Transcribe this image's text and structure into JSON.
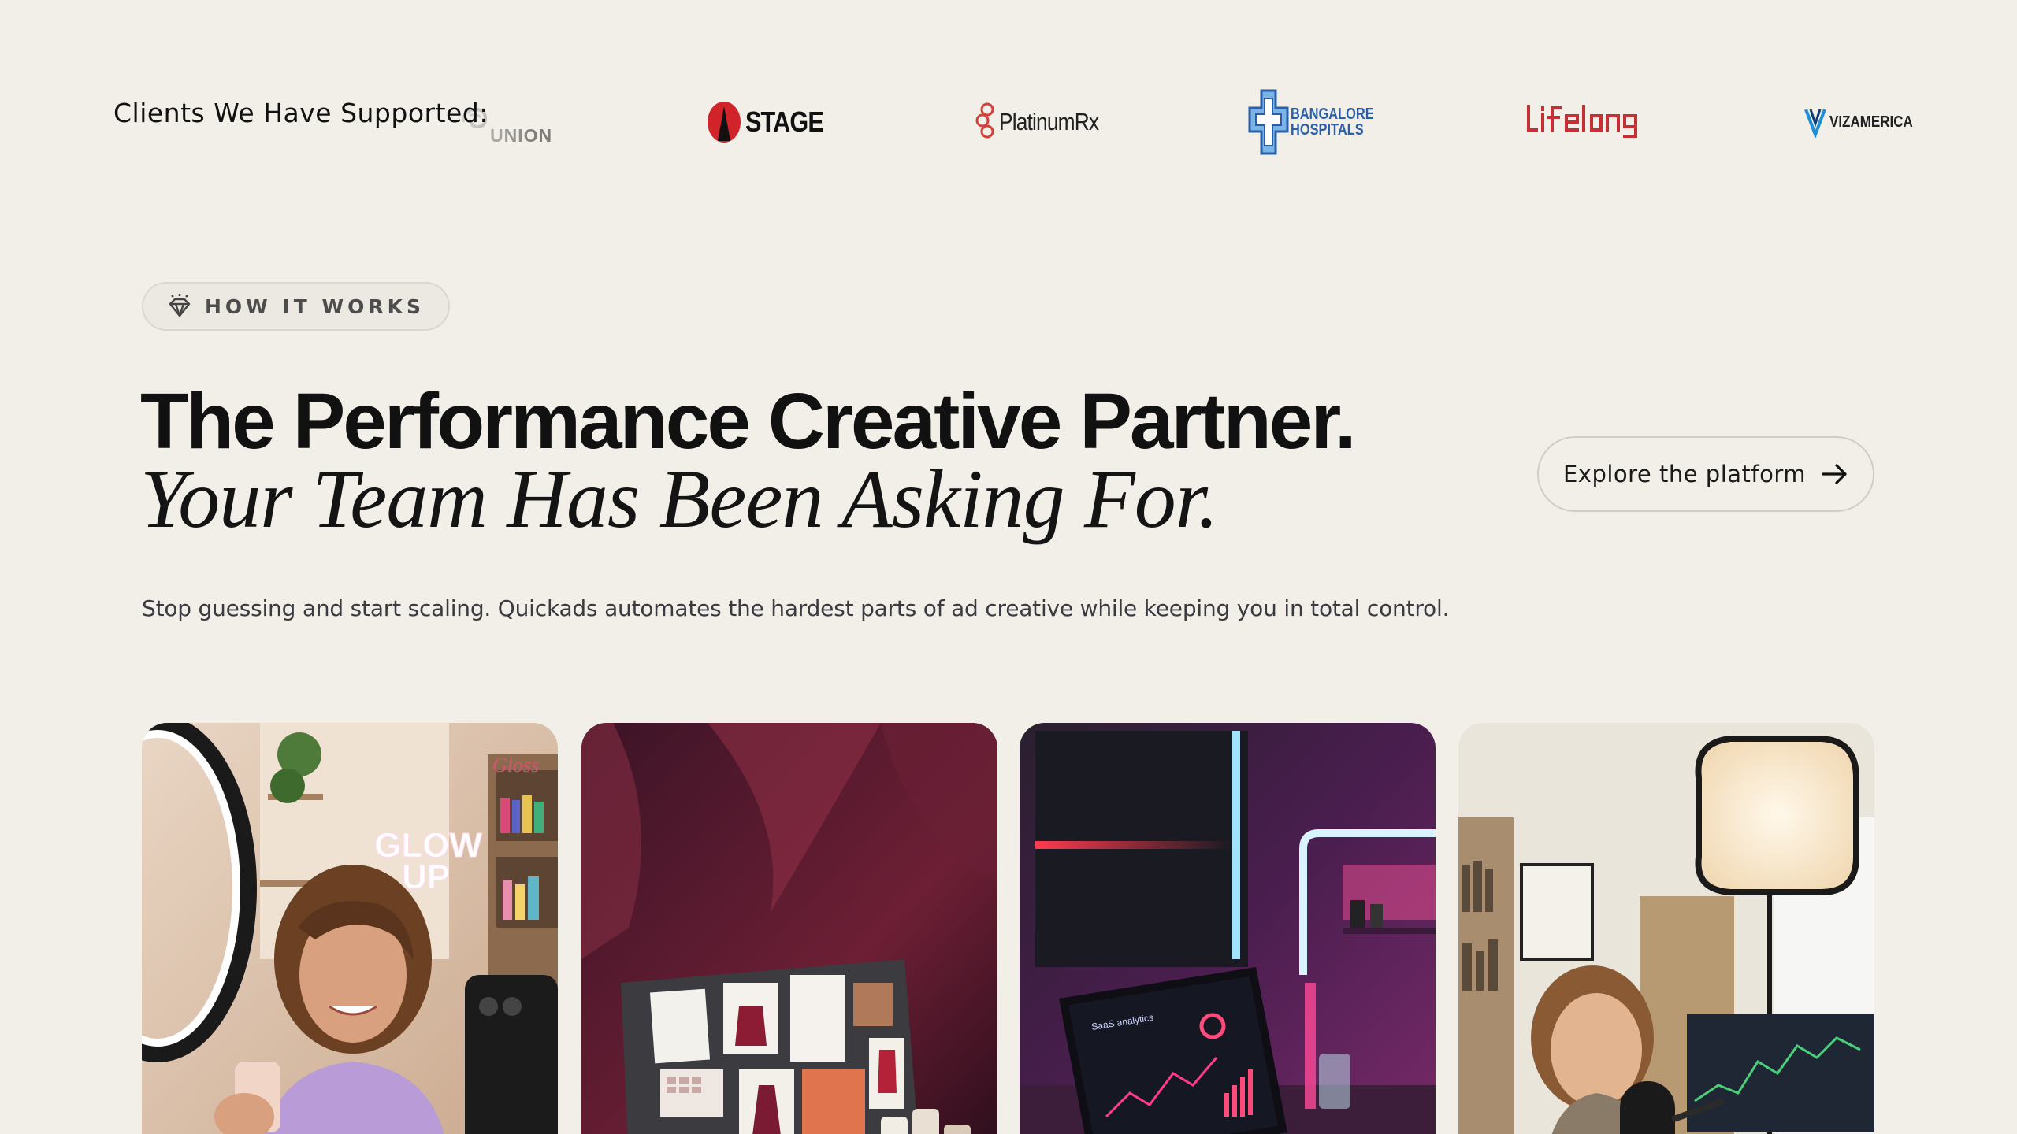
{
  "clients": {
    "label": "Clients We Have Supported:",
    "logos": [
      {
        "name": "UNION",
        "text": "UNION"
      },
      {
        "name": "STAGE",
        "text": "STAGE"
      },
      {
        "name": "PlatinumRx",
        "text": "PlatinumRx"
      },
      {
        "name": "Bangalore Hospitals",
        "line1": "BANGALORE",
        "line2": "HOSPITALS"
      },
      {
        "name": "Lifelong",
        "text": "Lifelong"
      },
      {
        "name": "VizAmerica",
        "text": "VIZAMERICA"
      }
    ]
  },
  "section": {
    "badge": "HOW IT WORKS",
    "headline_main": "The Performance Creative Partner.",
    "headline_sub": "Your Team Has Been Asking For.",
    "cta": "Explore the platform",
    "description": "Stop guessing and start scaling. Quickads automates the hardest parts of ad creative while keeping you in total control."
  },
  "cards": [
    {
      "name": "creator-beauty-card",
      "sign_text_1": "GLOW",
      "sign_text_2": "UP",
      "shelf_text": "Gloss"
    },
    {
      "name": "fashion-moodboard-card"
    },
    {
      "name": "analytics-desk-card",
      "screen_title": "SaaS analytics"
    },
    {
      "name": "podcast-presenter-card"
    }
  ],
  "colors": {
    "background": "#f1efe8",
    "stage_red": "#d1232a",
    "lifelong_red": "#c62f33",
    "bangalore_blue": "#2a5fa8",
    "platinum_red": "#d2413a"
  }
}
